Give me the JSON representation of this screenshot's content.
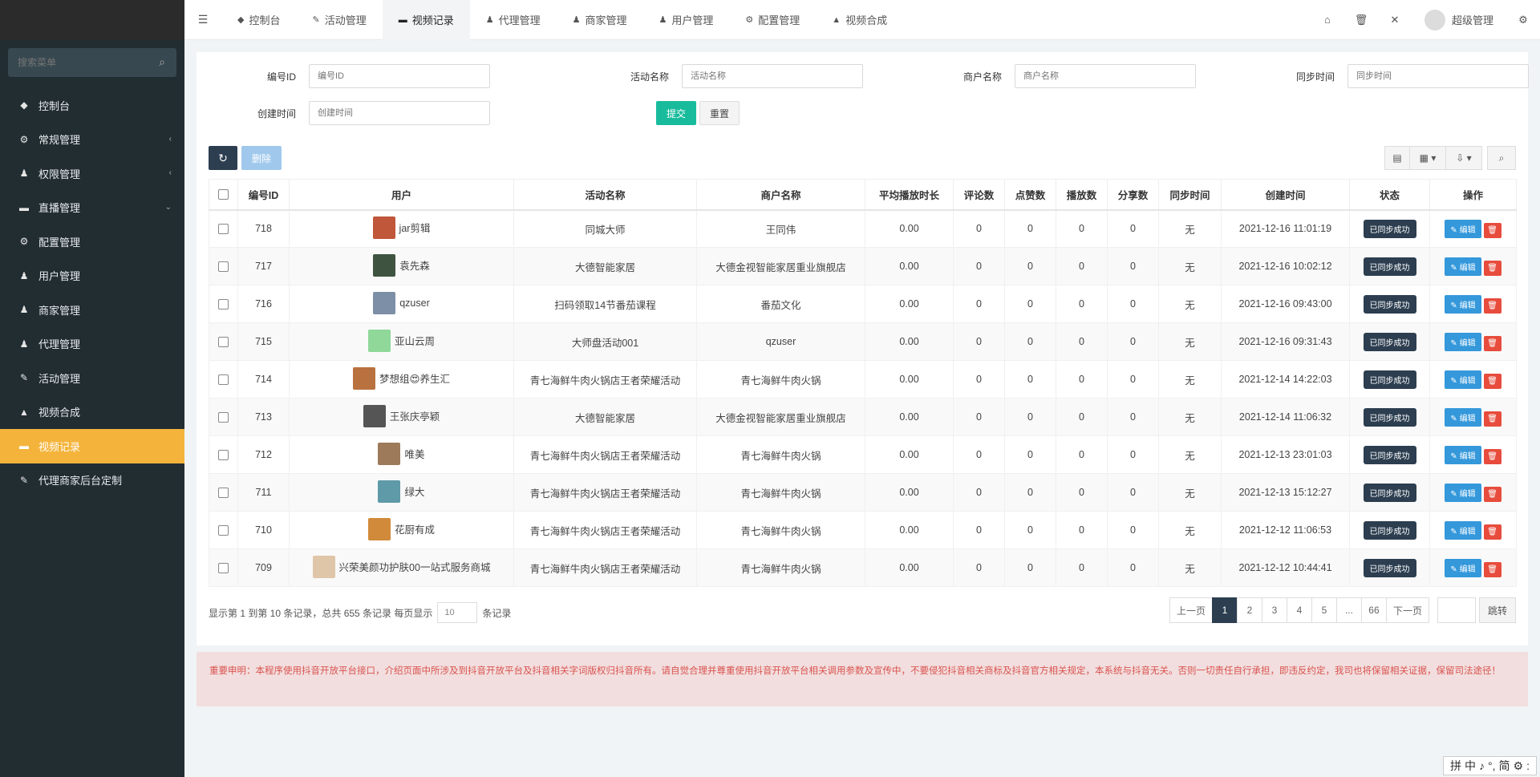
{
  "sidebar": {
    "brand": "",
    "search_placeholder": "搜索菜单",
    "items": [
      {
        "label": "控制台",
        "icon": "dashboard-icon",
        "glyph": "◆",
        "caret": ""
      },
      {
        "label": "常规管理",
        "icon": "cogs-icon",
        "glyph": "⚙",
        "caret": "‹"
      },
      {
        "label": "权限管理",
        "icon": "group-icon",
        "glyph": "♟",
        "caret": "‹"
      },
      {
        "label": "直播管理",
        "icon": "list-icon",
        "glyph": "▬",
        "caret": "⌄"
      },
      {
        "label": "配置管理",
        "icon": "gear-icon",
        "glyph": "⚙",
        "caret": ""
      },
      {
        "label": "用户管理",
        "icon": "user-icon",
        "glyph": "♟",
        "caret": ""
      },
      {
        "label": "商家管理",
        "icon": "user-icon",
        "glyph": "♟",
        "caret": ""
      },
      {
        "label": "代理管理",
        "icon": "group-icon",
        "glyph": "♟",
        "caret": ""
      },
      {
        "label": "活动管理",
        "icon": "tag-icon",
        "glyph": "✎",
        "caret": ""
      },
      {
        "label": "视频合成",
        "icon": "flask-icon",
        "glyph": "▲",
        "caret": ""
      },
      {
        "label": "视频记录",
        "icon": "video-icon",
        "glyph": "▬",
        "caret": "",
        "active": true
      },
      {
        "label": "代理商家后台定制",
        "icon": "pencil-icon",
        "glyph": "✎",
        "caret": ""
      }
    ]
  },
  "topbar": {
    "tabs": [
      {
        "label": "控制台",
        "glyph": "◆"
      },
      {
        "label": "活动管理",
        "glyph": "✎"
      },
      {
        "label": "视频记录",
        "glyph": "▬",
        "active": true
      },
      {
        "label": "代理管理",
        "glyph": "♟"
      },
      {
        "label": "商家管理",
        "glyph": "♟"
      },
      {
        "label": "用户管理",
        "glyph": "♟"
      },
      {
        "label": "配置管理",
        "glyph": "⚙"
      },
      {
        "label": "视频合成",
        "glyph": "▲"
      }
    ],
    "user_name": "超级管理"
  },
  "filter": {
    "id_label": "编号ID",
    "id_placeholder": "编号ID",
    "activity_label": "活动名称",
    "activity_placeholder": "活动名称",
    "merchant_label": "商户名称",
    "merchant_placeholder": "商户名称",
    "sync_label": "同步时间",
    "sync_placeholder": "同步时间",
    "created_label": "创建时间",
    "created_placeholder": "创建时间",
    "submit_label": "提交",
    "reset_label": "重置"
  },
  "toolbar": {
    "refresh_glyph": "↻",
    "delete_label": "删除"
  },
  "table": {
    "headers": [
      "编号ID",
      "用户",
      "活动名称",
      "商户名称",
      "平均播放时长",
      "评论数",
      "点赞数",
      "播放数",
      "分享数",
      "同步时间",
      "创建时间",
      "状态",
      "操作"
    ],
    "status_label": "已同步成功",
    "edit_label": "✎ 编辑",
    "delete_glyph": "🗑",
    "rows": [
      {
        "id": "718",
        "user": "jar剪辑",
        "avatar_color": "#c0563a",
        "activity": "同城大师",
        "merchant": "王同伟",
        "avg": "0.00",
        "comments": "0",
        "likes": "0",
        "plays": "0",
        "shares": "0",
        "sync": "无",
        "created": "2021-12-16 11:01:19"
      },
      {
        "id": "717",
        "user": "袁先森",
        "avatar_color": "#3f5440",
        "activity": "大德智能家居",
        "merchant": "大德金视智能家居重业旗舰店",
        "avg": "0.00",
        "comments": "0",
        "likes": "0",
        "plays": "0",
        "shares": "0",
        "sync": "无",
        "created": "2021-12-16 10:02:12"
      },
      {
        "id": "716",
        "user": "qzuser",
        "avatar_color": "#7d8fa6",
        "activity": "扫码领取14节番茄课程",
        "merchant": "番茄文化",
        "avg": "0.00",
        "comments": "0",
        "likes": "0",
        "plays": "0",
        "shares": "0",
        "sync": "无",
        "created": "2021-12-16 09:43:00"
      },
      {
        "id": "715",
        "user": "亚山云周",
        "avatar_color": "#8fd89a",
        "activity": "大师盘活动001",
        "merchant": "qzuser",
        "avg": "0.00",
        "comments": "0",
        "likes": "0",
        "plays": "0",
        "shares": "0",
        "sync": "无",
        "created": "2021-12-16 09:31:43"
      },
      {
        "id": "714",
        "user": "梦想组😍养生汇",
        "avatar_color": "#b9723f",
        "activity": "青七海鲜牛肉火锅店王者荣耀活动",
        "merchant": "青七海鲜牛肉火锅",
        "avg": "0.00",
        "comments": "0",
        "likes": "0",
        "plays": "0",
        "shares": "0",
        "sync": "无",
        "created": "2021-12-14 14:22:03"
      },
      {
        "id": "713",
        "user": "王张庆亭颖",
        "avatar_color": "#555555",
        "activity": "大德智能家居",
        "merchant": "大德金视智能家居重业旗舰店",
        "avg": "0.00",
        "comments": "0",
        "likes": "0",
        "plays": "0",
        "shares": "0",
        "sync": "无",
        "created": "2021-12-14 11:06:32"
      },
      {
        "id": "712",
        "user": "唯美",
        "avatar_color": "#9c7a5a",
        "activity": "青七海鲜牛肉火锅店王者荣耀活动",
        "merchant": "青七海鲜牛肉火锅",
        "avg": "0.00",
        "comments": "0",
        "likes": "0",
        "plays": "0",
        "shares": "0",
        "sync": "无",
        "created": "2021-12-13 23:01:03"
      },
      {
        "id": "711",
        "user": "绿大",
        "avatar_color": "#5e9aa8",
        "activity": "青七海鲜牛肉火锅店王者荣耀活动",
        "merchant": "青七海鲜牛肉火锅",
        "avg": "0.00",
        "comments": "0",
        "likes": "0",
        "plays": "0",
        "shares": "0",
        "sync": "无",
        "created": "2021-12-13 15:12:27"
      },
      {
        "id": "710",
        "user": "花厨有成",
        "avatar_color": "#d08a3a",
        "activity": "青七海鲜牛肉火锅店王者荣耀活动",
        "merchant": "青七海鲜牛肉火锅",
        "avg": "0.00",
        "comments": "0",
        "likes": "0",
        "plays": "0",
        "shares": "0",
        "sync": "无",
        "created": "2021-12-12 11:06:53"
      },
      {
        "id": "709",
        "user": "兴荣美颜功护肤00一站式服务商城",
        "avatar_color": "#e0c6a8",
        "activity": "青七海鲜牛肉火锅店王者荣耀活动",
        "merchant": "青七海鲜牛肉火锅",
        "avg": "0.00",
        "comments": "0",
        "likes": "0",
        "plays": "0",
        "shares": "0",
        "sync": "无",
        "created": "2021-12-12 10:44:41"
      }
    ]
  },
  "pagination": {
    "info_prefix": "显示第 1 到第 10 条记录，总共 655 条记录 每页显示",
    "page_size": "10",
    "info_suffix": "条记录",
    "prev": "上一页",
    "pages": [
      "1",
      "2",
      "3",
      "4",
      "5",
      "...",
      "66"
    ],
    "next": "下一页",
    "go": "跳转"
  },
  "notice": {
    "text": "重要申明：本程序使用抖音开放平台接口，介绍页面中所涉及到抖音开放平台及抖音相关字词版权归抖音所有。请自觉合理并尊重使用抖音开放平台相关调用参数及宣传中，不要侵犯抖音相关商标及抖音官方相关规定，本系统与抖音无关。否则一切责任自行承担，即违反约定，我司也将保留相关证据，保留司法途径！"
  },
  "ime": [
    "拼",
    "中",
    "♪",
    "°,",
    "简",
    "⚙",
    ":"
  ]
}
